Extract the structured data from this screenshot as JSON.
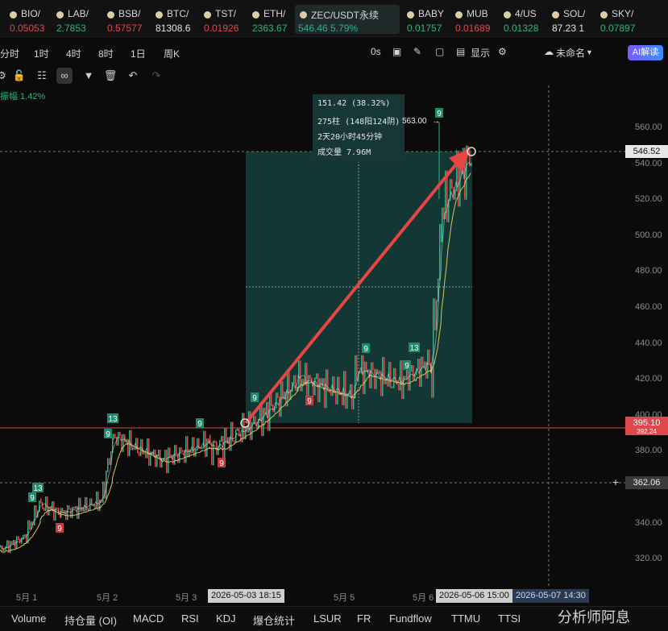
{
  "tickers": [
    {
      "sym": "BIO/",
      "price": "0.05053",
      "dir": "down",
      "x": 0
    },
    {
      "sym": "LAB/",
      "price": "2.7853",
      "dir": "up",
      "x": 70
    },
    {
      "sym": "BSB/",
      "price": "0.57577",
      "dir": "down",
      "x": 133
    },
    {
      "sym": "BTC/",
      "price": "81308.6",
      "dir": "neutral",
      "x": 193
    },
    {
      "sym": "TST/",
      "price": "0.01926",
      "dir": "down",
      "x": 253
    },
    {
      "sym": "ETH/",
      "price": "2363.67",
      "dir": "up",
      "x": 313
    },
    {
      "sym": "ZEC/USDT永续",
      "price": "546.46  5.79%",
      "dir": "up",
      "x": 370,
      "active": true
    },
    {
      "sym": "BABY",
      "price": "0.01757",
      "dir": "up",
      "x": 508
    },
    {
      "sym": "MUB",
      "price": "0.01689",
      "dir": "down",
      "x": 568
    },
    {
      "sym": "4/US",
      "price": "0.01328",
      "dir": "up",
      "x": 628
    },
    {
      "sym": "SOL/",
      "price": "87.23 1",
      "dir": "neutral",
      "x": 688
    },
    {
      "sym": "SKY/",
      "price": "0.07897",
      "dir": "up",
      "x": 748
    }
  ],
  "intervals": [
    "分时",
    "1时",
    "4时",
    "8时",
    "1日",
    "周K"
  ],
  "toolbar_right": {
    "time": "0s",
    "display": "显示",
    "layout": "未命名",
    "ai": "AI解读"
  },
  "amplitude": "振幅 1.42%",
  "info_box": {
    "line1": "151.42 (38.32%)",
    "line2": "275柱 (148阳124阴)",
    "line3": "2天20小时45分钟",
    "line4": "成交量 7.96M"
  },
  "high_marker": "563.00",
  "y_ticks": [
    "560.00",
    "540.00",
    "520.00",
    "500.00",
    "480.00",
    "460.00",
    "440.00",
    "420.00",
    "400.00",
    "380.00",
    "360.00",
    "340.00",
    "320.00"
  ],
  "price_badges": {
    "current": "546.52",
    "line": "395.10",
    "line_sub": "392.24",
    "cross": "362.06"
  },
  "x_labels": [
    "5月 1",
    "5月 2",
    "5月 3",
    "5月 5",
    "5月 6"
  ],
  "x_badges": {
    "start": "2026-05-03 18:15",
    "end": "2026-05-06 15:00",
    "cursor": "2026-05-07 14:30"
  },
  "td_labels": [
    {
      "t": "13",
      "c": "up"
    },
    {
      "t": "9",
      "c": "up"
    },
    {
      "t": "13",
      "c": "up"
    },
    {
      "t": "9",
      "c": "up"
    },
    {
      "t": "9",
      "c": "up"
    },
    {
      "t": "9",
      "c": "up"
    },
    {
      "t": "9",
      "c": "up"
    },
    {
      "t": "13",
      "c": "up"
    },
    {
      "t": "9",
      "c": "up"
    },
    {
      "t": "9",
      "c": "up"
    },
    {
      "t": "9",
      "c": "down"
    },
    {
      "t": "9",
      "c": "down"
    },
    {
      "t": "9",
      "c": "down"
    }
  ],
  "indicators": [
    "Volume",
    "持仓量 (OI)",
    "MACD",
    "RSI",
    "KDJ",
    "爆仓统计",
    "LSUR",
    "FR",
    "Fundflow",
    "TTMU",
    "TTSI"
  ],
  "watermark": "分析师阿息",
  "colors": {
    "up": "#2fb08c",
    "down": "#e0474c",
    "arrow": "#e84545",
    "box": "#173636",
    "ma": "#d4c65a"
  }
}
